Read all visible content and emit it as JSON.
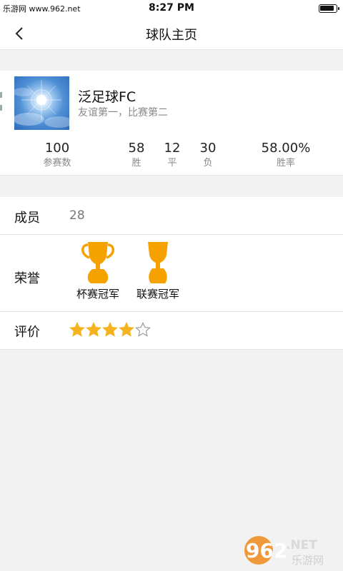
{
  "status_bar": {
    "carrier": "乐游网 www.962.net",
    "time": "8:27 PM",
    "battery_level": 0.9
  },
  "navbar": {
    "back_icon": "chevron-left-icon",
    "title": "球队主页"
  },
  "team": {
    "logo_icon": "sky-sun-image",
    "name": "泛足球FC",
    "motto": "友谊第一，比赛第二",
    "stats": [
      {
        "value": "100",
        "label": "参赛数"
      },
      {
        "value": "58",
        "label": "胜"
      },
      {
        "value": "12",
        "label": "平"
      },
      {
        "value": "30",
        "label": "负"
      },
      {
        "value": "58.00%",
        "label": "胜率"
      }
    ]
  },
  "members": {
    "label": "成员",
    "value": "28"
  },
  "honors": {
    "label": "荣誉",
    "items": [
      {
        "name": "杯赛冠军",
        "icon": "cup-trophy-icon"
      },
      {
        "name": "联赛冠军",
        "icon": "league-trophy-icon"
      }
    ]
  },
  "rating": {
    "label": "评价",
    "stars": 4,
    "max_stars": 5
  },
  "colors": {
    "trophy": "#F5A100",
    "star": "#F6B321",
    "background": "#F2F2F2"
  },
  "watermark": {
    "brand": "962",
    "suffix": ".NET",
    "subtitle": "乐游网"
  }
}
